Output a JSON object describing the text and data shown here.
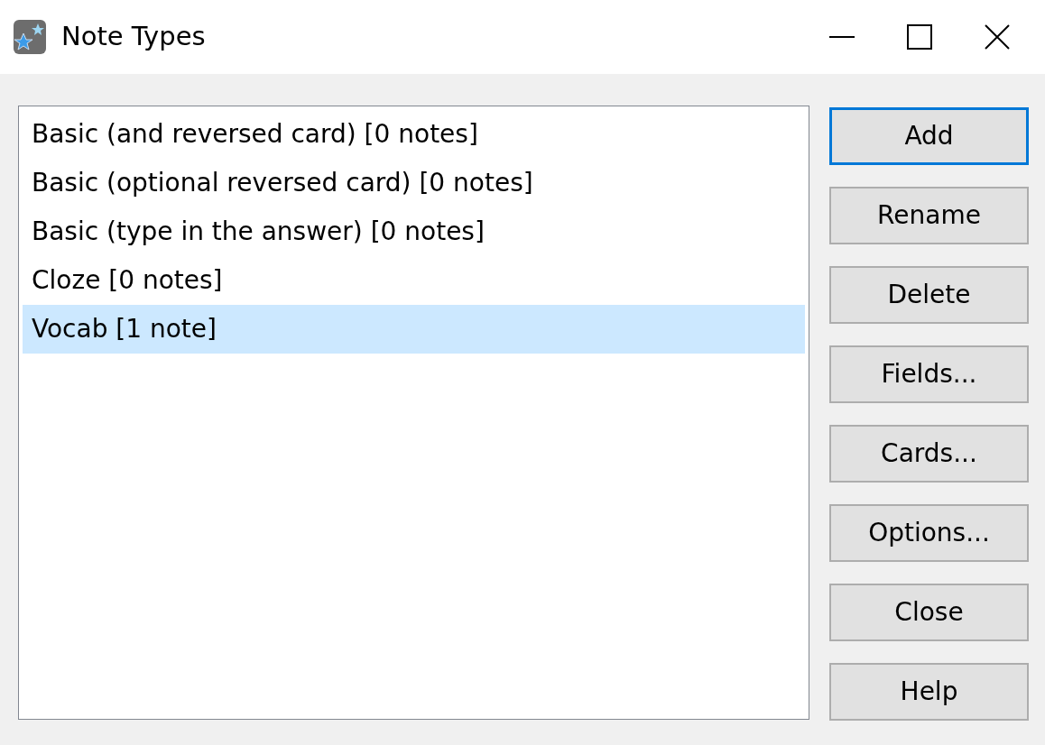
{
  "window": {
    "title": "Note Types"
  },
  "note_types": [
    {
      "label": "Basic (and reversed card) [0 notes]",
      "selected": false
    },
    {
      "label": "Basic (optional reversed card) [0 notes]",
      "selected": false
    },
    {
      "label": "Basic (type in the answer) [0 notes]",
      "selected": false
    },
    {
      "label": "Cloze [0 notes]",
      "selected": false
    },
    {
      "label": "Vocab [1 note]",
      "selected": true
    }
  ],
  "buttons": [
    {
      "label": "Add",
      "focused": true
    },
    {
      "label": "Rename",
      "focused": false
    },
    {
      "label": "Delete",
      "focused": false
    },
    {
      "label": "Fields...",
      "focused": false
    },
    {
      "label": "Cards...",
      "focused": false
    },
    {
      "label": "Options...",
      "focused": false
    },
    {
      "label": "Close",
      "focused": false
    },
    {
      "label": "Help",
      "focused": false
    }
  ]
}
